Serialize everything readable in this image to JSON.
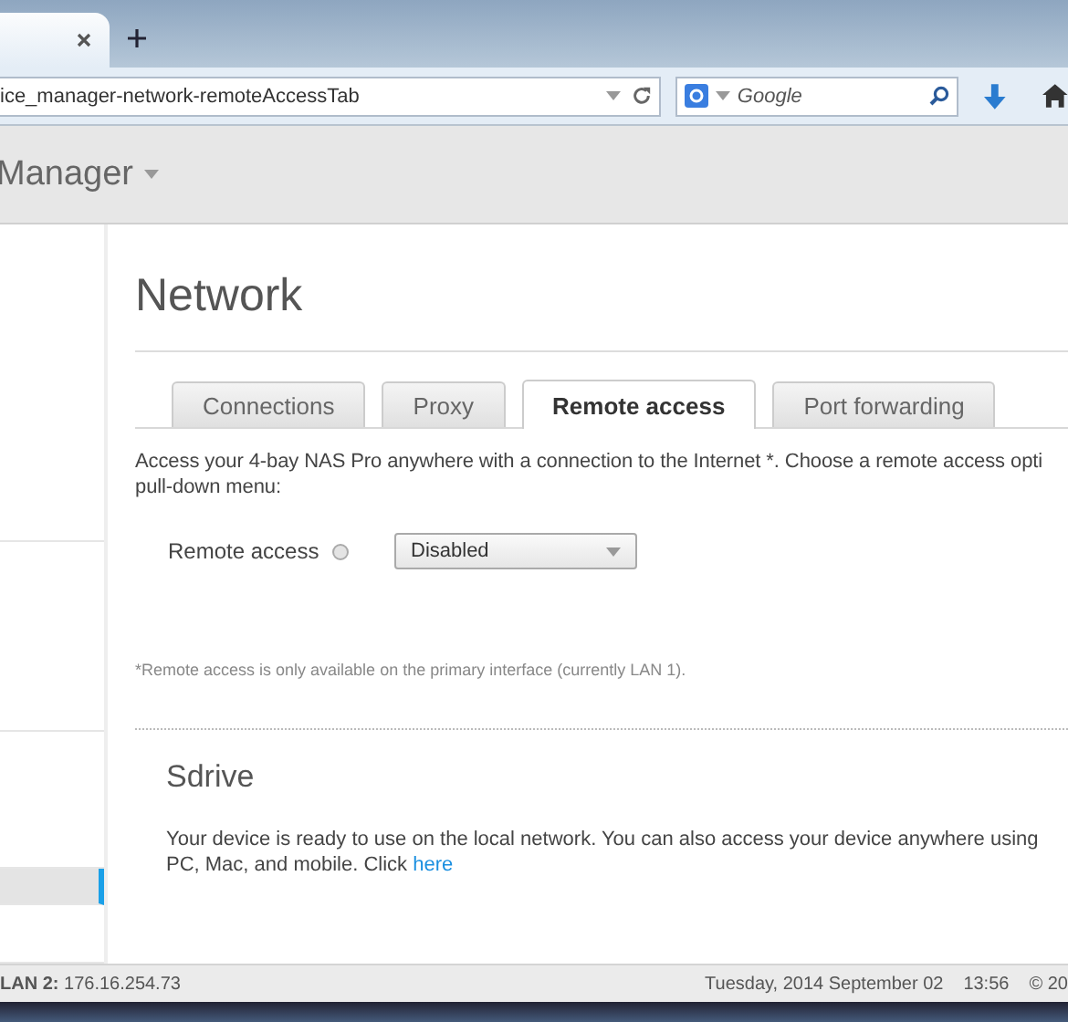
{
  "browser": {
    "address": "ice_manager-network-remoteAccessTab",
    "search_placeholder": "Google"
  },
  "header": {
    "title": "Manager"
  },
  "sidebar": {
    "items": [
      {
        "selected": false
      },
      {
        "selected": false
      },
      {
        "selected": false
      },
      {
        "selected": true
      },
      {
        "selected": false
      }
    ]
  },
  "page": {
    "title": "Network",
    "tabs": [
      {
        "label": "Connections",
        "selected": false
      },
      {
        "label": "Proxy",
        "selected": false
      },
      {
        "label": "Remote access",
        "selected": true
      },
      {
        "label": "Port forwarding",
        "selected": false
      }
    ],
    "intro_lines": [
      "Access your 4-bay NAS Pro anywhere with a connection to the Internet *. Choose a remote access opti",
      "pull-down menu:"
    ],
    "setting": {
      "label": "Remote access",
      "value": "Disabled",
      "enabled": false
    },
    "footnote": "*Remote access is only available on the primary interface (currently LAN 1).",
    "sdrive": {
      "title": "Sdrive",
      "lines": [
        "Your device is ready to use on the local network. You can also access your device anywhere using",
        "PC, Mac, and mobile. Click"
      ],
      "link": "here"
    }
  },
  "status_bar": {
    "lan": "**LAN 2:** 176.16.254.73",
    "date": "Tuesday, 2014 September 02",
    "time": "13:56",
    "copyright": "© 20"
  }
}
